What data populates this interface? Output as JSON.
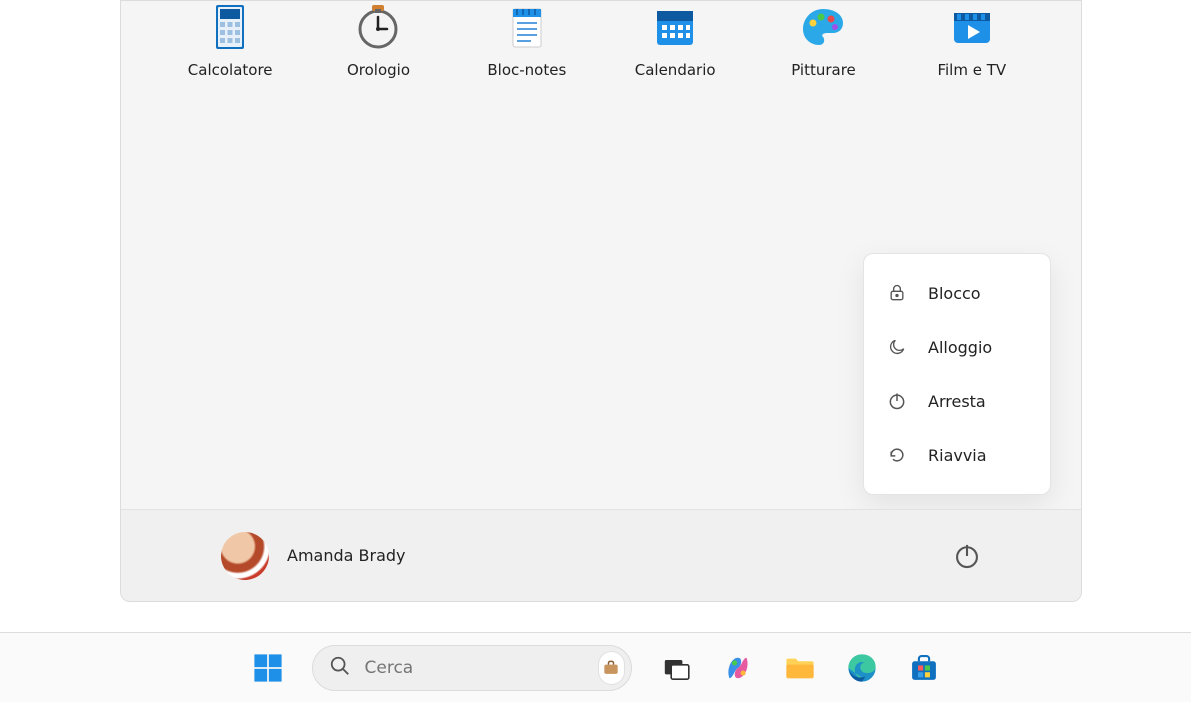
{
  "apps": [
    {
      "id": "calculator",
      "label": "Calcolatore"
    },
    {
      "id": "clock",
      "label": "Orologio"
    },
    {
      "id": "notepad",
      "label": "Bloc-notes"
    },
    {
      "id": "calendar",
      "label": "Calendario"
    },
    {
      "id": "paint",
      "label": "Pitturare"
    },
    {
      "id": "movies",
      "label": "Film e TV"
    }
  ],
  "power_menu": {
    "lock": "Blocco",
    "sleep": "Alloggio",
    "shutdown": "Arresta",
    "restart": "Riavvia"
  },
  "user": {
    "name": "Amanda Brady"
  },
  "taskbar": {
    "search_placeholder": "Cerca"
  }
}
